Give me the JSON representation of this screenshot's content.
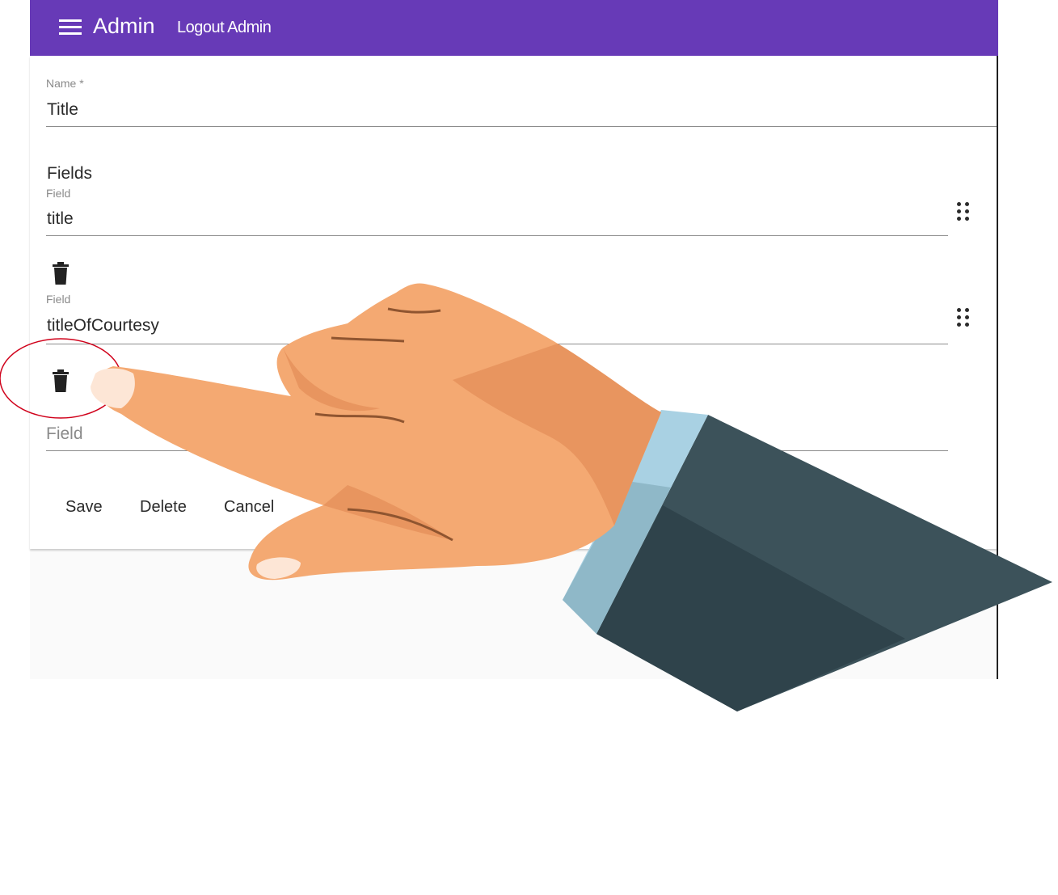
{
  "header": {
    "menu_icon": "menu-icon",
    "title": "Admin",
    "logout_label": "Logout Admin",
    "background": "#673ab7"
  },
  "form": {
    "name_label": "Name *",
    "name_value": "Title",
    "fields_title": "Fields",
    "fields": [
      {
        "label": "Field",
        "value": "title",
        "drag_icon": "drag-handle-icon",
        "delete_icon": "trash-icon"
      },
      {
        "label": "Field",
        "value": "titleOfCourtesy",
        "drag_icon": "drag-handle-icon",
        "delete_icon": "trash-icon"
      }
    ],
    "new_field_placeholder": "Field"
  },
  "actions": {
    "save_label": "Save",
    "delete_label": "Delete",
    "cancel_label": "Cancel"
  },
  "overlay": {
    "highlight_color": "#d0021b",
    "pointer_illustration": "pointing-hand"
  }
}
